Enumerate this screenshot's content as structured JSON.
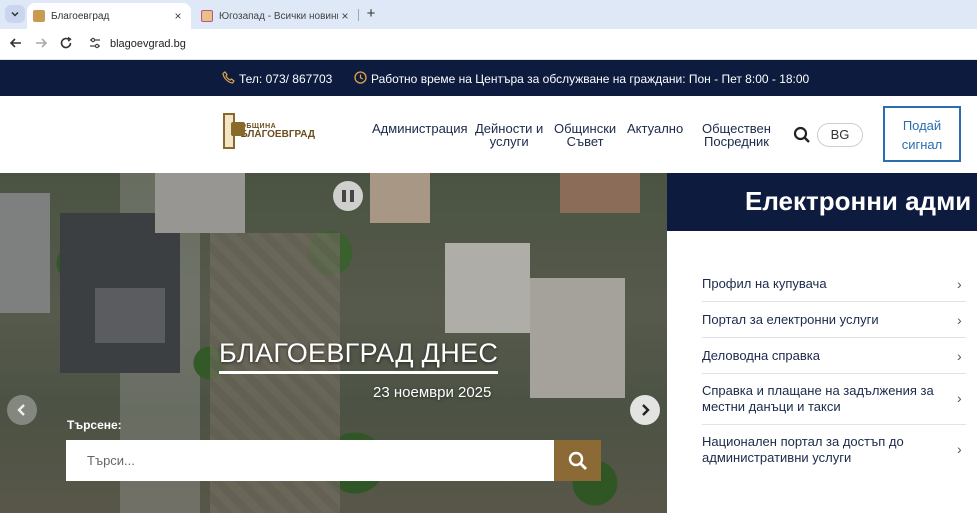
{
  "browser": {
    "tabs": [
      {
        "title": "Благоевград",
        "active": true
      },
      {
        "title": "Югозапад - Всички новини от",
        "active": false
      }
    ],
    "new_tab_label": "+",
    "close_label": "×",
    "url": "blagoevgrad.bg"
  },
  "infobar": {
    "phone": "Тел: 073/ 867703",
    "hours": "Работно време на Центъра за обслужване на граждани: Пон - Пет 8:00 - 18:00"
  },
  "header": {
    "logo_line1": "ОБЩИНА",
    "logo_line2": "БЛАГОЕВГРАД",
    "menu": [
      {
        "line1": "Администрация",
        "line2": ""
      },
      {
        "line1": "Дейности и",
        "line2": "услуги"
      },
      {
        "line1": "Общински",
        "line2": "Съвет"
      },
      {
        "line1": "Актуално",
        "line2": ""
      },
      {
        "line1": "Обществен",
        "line2": "Посредник"
      }
    ],
    "lang": "BG",
    "signal_line1": "Подай",
    "signal_line2": "сигнал"
  },
  "hero": {
    "title": "БЛАГОЕВГРАД ДНЕС",
    "date": "23 ноември 2025",
    "search_label": "Търсене:",
    "search_placeholder": "Търси..."
  },
  "eadmin": {
    "title": "Електронни адми",
    "items": [
      {
        "line1": "Профил на купувача",
        "line2": ""
      },
      {
        "line1": "Портал за електронни услуги",
        "line2": ""
      },
      {
        "line1": "Деловодна справка",
        "line2": ""
      },
      {
        "line1": "Справка и плащане на задължения за",
        "line2": "местни данъци и такси"
      },
      {
        "line1": "Национален портал за достъп до",
        "line2": "административни услуги"
      }
    ]
  },
  "colors": {
    "navy": "#0d1b3e",
    "gold": "#8c6a36",
    "accent_blue": "#2a6db0"
  },
  "icons": {
    "phone": "phone-icon",
    "clock": "clock-icon",
    "search": "search-icon",
    "pause": "pause-icon",
    "prev": "chevron-left-icon",
    "next": "chevron-right-icon"
  }
}
